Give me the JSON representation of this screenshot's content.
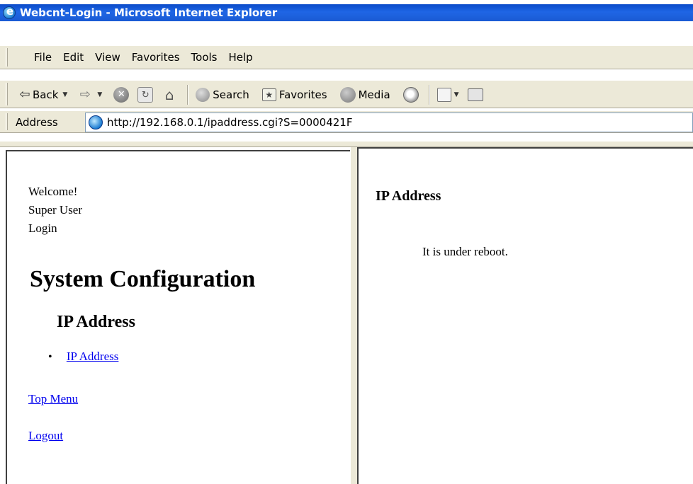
{
  "window": {
    "title": "Webcnt-Login - Microsoft Internet Explorer"
  },
  "menu": [
    "File",
    "Edit",
    "View",
    "Favorites",
    "Tools",
    "Help"
  ],
  "toolbar": {
    "back_label": "Back",
    "search_label": "Search",
    "favorites_label": "Favorites",
    "media_label": "Media"
  },
  "address": {
    "label": "Address",
    "url": "http://192.168.0.1/ipaddress.cgi?S=0000421F"
  },
  "left_frame": {
    "welcome_lines": [
      "Welcome!",
      "Super User",
      "Login"
    ],
    "section_title": "System Configuration",
    "subsection_title": "IP Address",
    "links": [
      "IP Address"
    ],
    "top_menu_link": "Top Menu",
    "logout_link": "Logout"
  },
  "right_frame": {
    "title": "IP Address",
    "message": "It is under reboot."
  },
  "colors": {
    "titlebar": "#0a4bc9",
    "chrome": "#ece9d8",
    "link": "#0000ee"
  }
}
